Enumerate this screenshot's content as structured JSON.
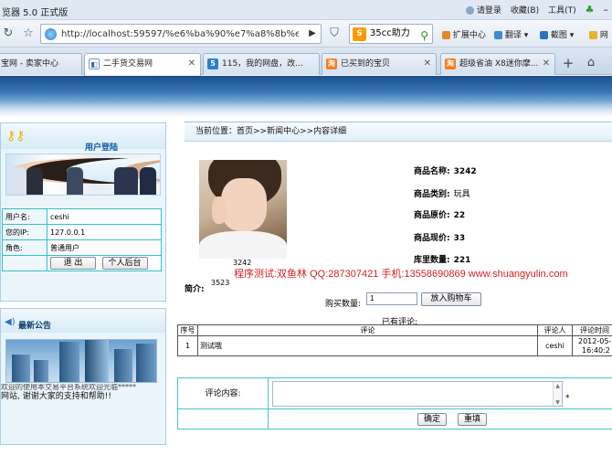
{
  "browser": {
    "title": "览器 5.0 正式版",
    "right_items": [
      "请登录",
      "收藏(B)",
      "工具(T)"
    ],
    "url": "http://localhost:59597/%e6%ba%90%e7%a8%8b%e5",
    "search_text": "35cc助力",
    "toolbar_links": [
      "扩展中心",
      "翻译",
      "截图",
      "网"
    ],
    "tabs": [
      {
        "label": "宝网 - 卖家中心",
        "active": false
      },
      {
        "label": "二手货交易网",
        "active": true
      },
      {
        "label": "115，我的网盘，改...",
        "active": false
      },
      {
        "label": "已买到的宝贝",
        "active": false
      },
      {
        "label": "超级省油 X8迷你摩...",
        "active": false
      }
    ]
  },
  "login": {
    "title": "用户登陆",
    "rows": [
      {
        "key": "用户名:",
        "value": "ceshi"
      },
      {
        "key": "您的IP:",
        "value": "127.0.0.1"
      },
      {
        "key": "角色:",
        "value": "普通用户"
      }
    ],
    "logout_label": "退  出",
    "backend_label": "个人后台"
  },
  "notice": {
    "title": "最新公告",
    "cut_text": "欢迎的使用本交易平台系统欢迎光临*****",
    "text": "网站, 谢谢大家的支持和帮助!!"
  },
  "breadcrumb": "当前位置：首页>>新闻中心>>内容详细",
  "product": {
    "image_caption": "3242",
    "fields": [
      {
        "label": "商品名称:",
        "value": "3242",
        "bold": true
      },
      {
        "label": "商品类别:",
        "value": "玩具",
        "bold": false
      },
      {
        "label": "商品原价:",
        "value": "22",
        "bold": true
      },
      {
        "label": "商品现价:",
        "value": "33",
        "bold": true
      },
      {
        "label": "库里数量:",
        "value": "221",
        "bold": true
      }
    ],
    "intro_label": "简介:",
    "intro_text": "3523"
  },
  "watermark": "程序测试:双鱼林 QQ:287307421 手机:13558690869 www.shuangyulin.com",
  "purchase": {
    "qty_label": "购买数量:",
    "qty_value": "1",
    "cart_label": "放入购物车"
  },
  "comments": {
    "title": "已有评论:",
    "headers": [
      "序号",
      "评论",
      "评论人",
      "评论时间"
    ],
    "rows": [
      {
        "index": "1",
        "content": "测试哦",
        "author": "ceshi",
        "date": "2012-05-",
        "time": "16:40:2"
      }
    ]
  },
  "comment_form": {
    "label": "评论内容:",
    "value": "",
    "required": "*",
    "submit_label": "确定",
    "reset_label": "重填"
  }
}
